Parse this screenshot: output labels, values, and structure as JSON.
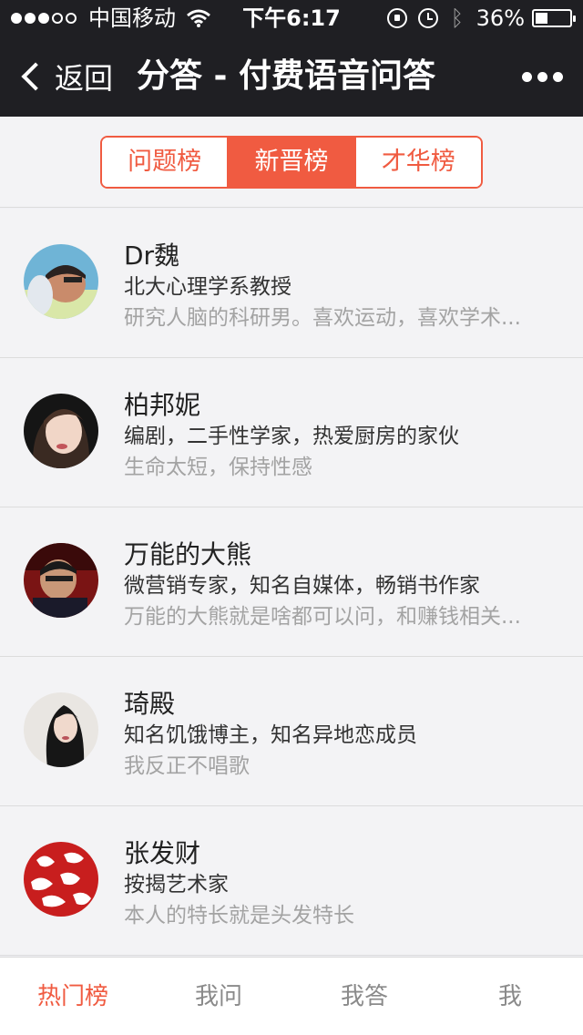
{
  "status_bar": {
    "signal_filled": 3,
    "signal_total": 5,
    "carrier": "中国移动",
    "time": "下午6:17",
    "battery_percent": "36%",
    "battery_level": 0.36
  },
  "navbar": {
    "back_label": "返回",
    "title": "分答 - 付费语音问答",
    "more_icon": "more-dots-icon"
  },
  "segments": [
    {
      "label": "问题榜",
      "active": false
    },
    {
      "label": "新晋榜",
      "active": true
    },
    {
      "label": "才华榜",
      "active": false
    }
  ],
  "list": [
    {
      "name": "Dr魏",
      "title": "北大心理学系教授",
      "desc": "研究人脑的科研男。喜欢运动，喜欢学术..."
    },
    {
      "name": "柏邦妮",
      "title": "编剧，二手性学家，热爱厨房的家伙",
      "desc": "生命太短，保持性感"
    },
    {
      "name": "万能的大熊",
      "title": "微营销专家，知名自媒体，畅销书作家",
      "desc": "万能的大熊就是啥都可以问，和赚钱相关..."
    },
    {
      "name": "琦殿",
      "title": "知名饥饿博主，知名异地恋成员",
      "desc": "我反正不唱歌"
    },
    {
      "name": "张发财",
      "title": "按揭艺术家",
      "desc": "本人的特长就是头发特长"
    }
  ],
  "tabbar": [
    {
      "label": "热门榜",
      "active": true
    },
    {
      "label": "我问",
      "active": false
    },
    {
      "label": "我答",
      "active": false
    },
    {
      "label": "我",
      "active": false
    }
  ],
  "colors": {
    "accent": "#f05b41",
    "topbar": "#1f1f23",
    "background": "#efeff4"
  }
}
